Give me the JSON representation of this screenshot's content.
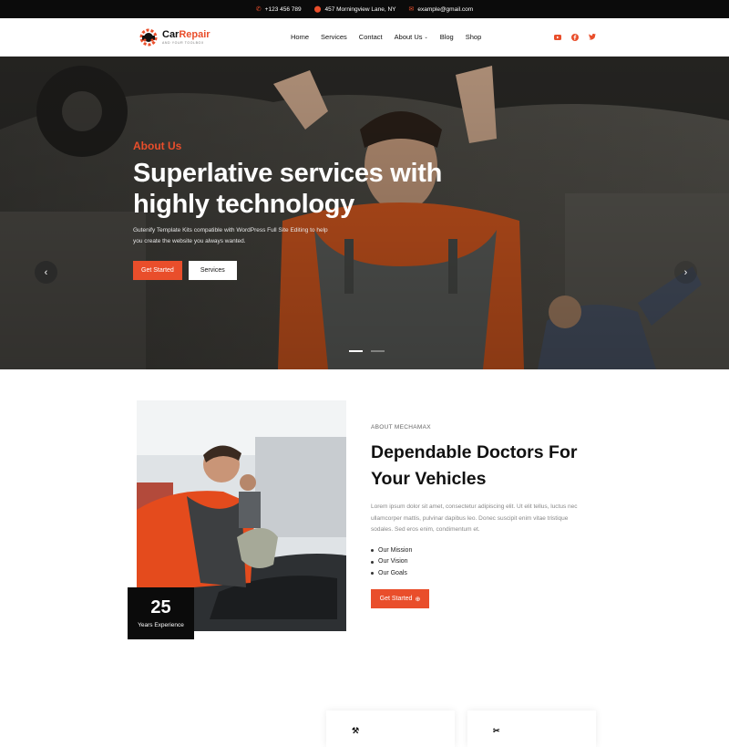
{
  "topbar": {
    "phone": "+123 456 789",
    "address": "457 Morningview Lane, NY",
    "email": "example@gmail.com",
    "icons": [
      "phone-icon",
      "location-pin-icon",
      "mail-icon"
    ]
  },
  "header": {
    "brand_part1": "Car",
    "brand_part2": "Repair",
    "tagline": "AND YOUR TOOLBOX",
    "nav": [
      "Home",
      "Services",
      "Contact",
      "About Us",
      "Blog",
      "Shop"
    ],
    "social": [
      "youtube-icon",
      "facebook-icon",
      "twitter-icon"
    ]
  },
  "hero": {
    "kicker": "About Us",
    "title": "Superlative services with highly technology",
    "description": "Gutenify Template Kits compatible with WordPress Full Site Editing to help you create the website you always wanted.",
    "primary_button": "Get Started",
    "secondary_button": "Services",
    "slides_total": 2,
    "active_slide": 1
  },
  "about": {
    "kicker": "ABOUT MECHAMAX",
    "title": "Dependable Doctors For Your Vehicles",
    "description": "Lorem ipsum dolor sit amet, consectetur adipiscing elit. Ut elit tellus, luctus nec ullamcorper mattis, pulvinar dapibus leo. Donec suscipit enim vitae tristique sodales. Sed eros enim, condimentum et.",
    "list": [
      "Our Mission",
      "Our Vision",
      "Our Goals"
    ],
    "button": "Get Started",
    "experience_number": "25",
    "experience_label": "Years Experience"
  },
  "colors": {
    "accent": "#e94e2b",
    "dark": "#0b0b0b"
  }
}
